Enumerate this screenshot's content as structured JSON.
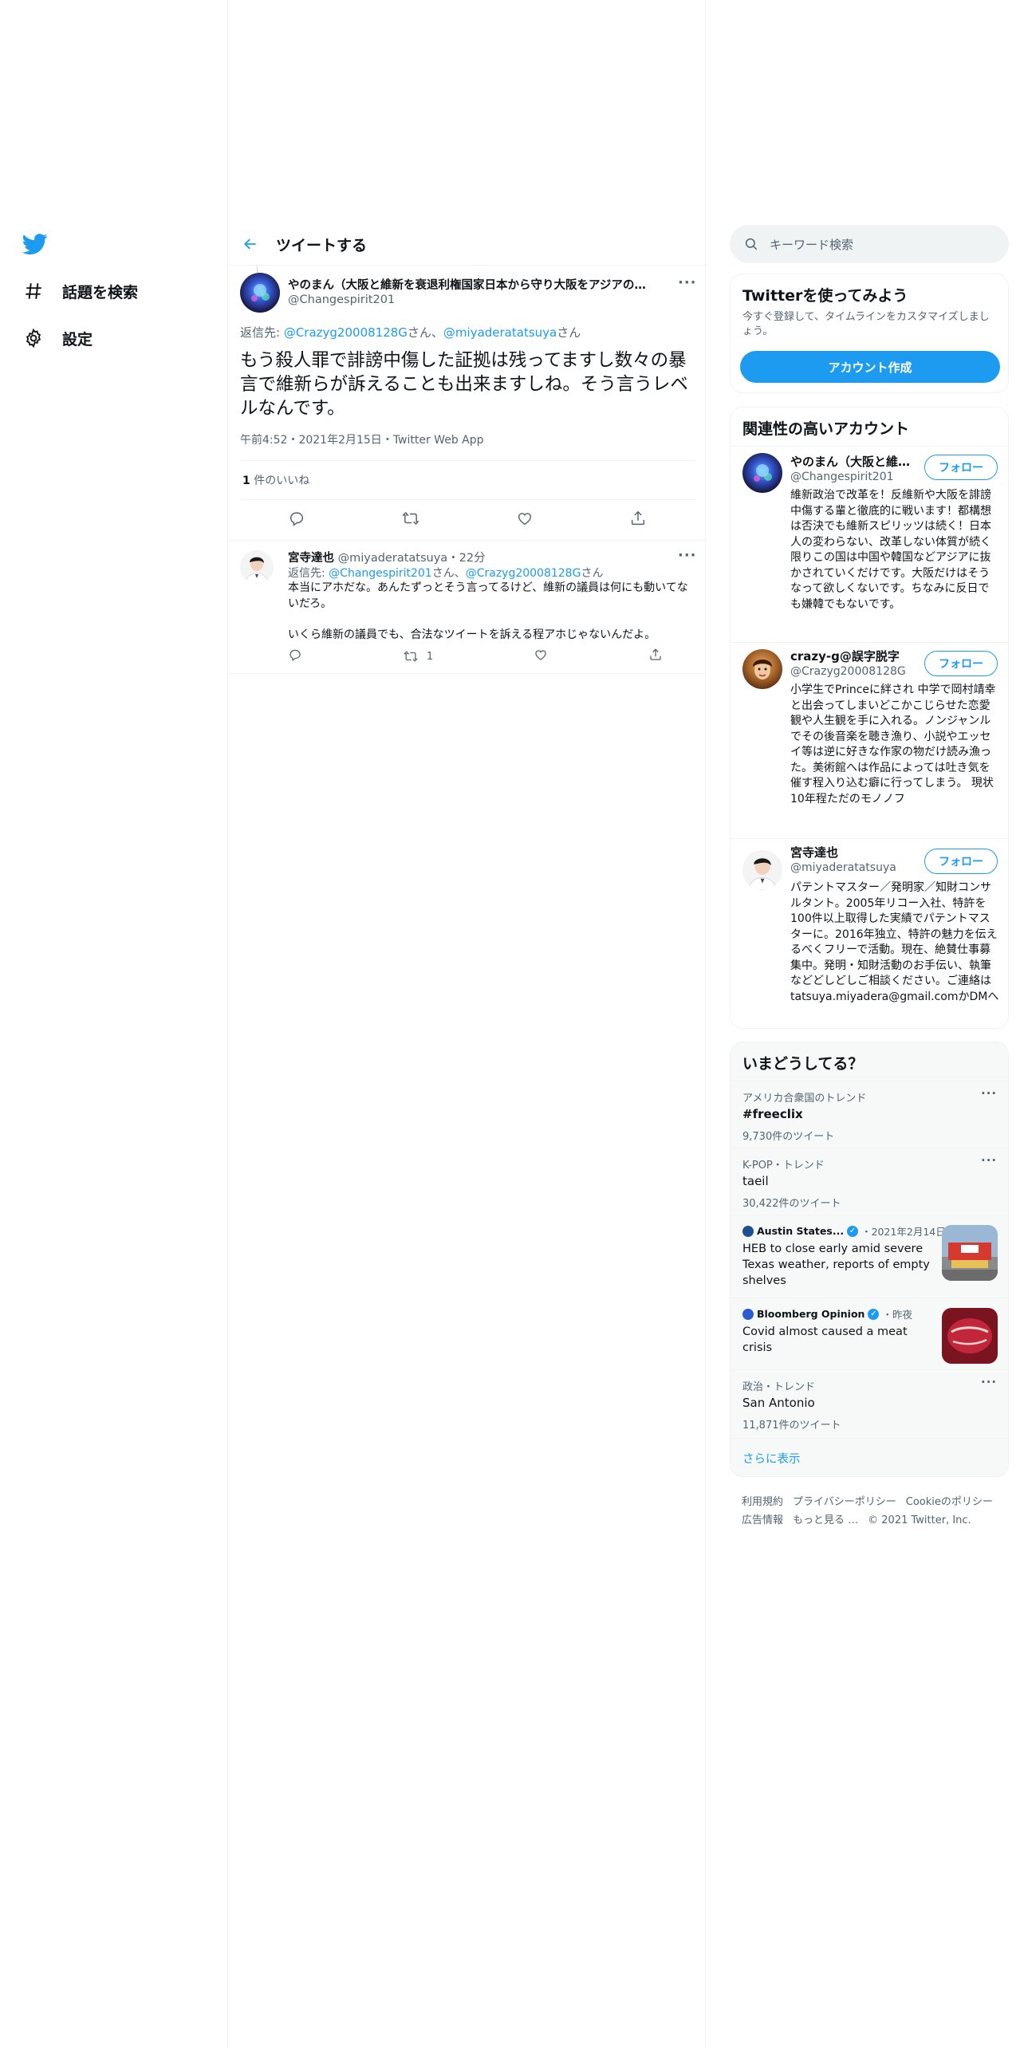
{
  "nav": {
    "explore_label": "話題を検索",
    "settings_label": "設定"
  },
  "header": {
    "title": "ツイートする"
  },
  "main_tweet": {
    "author_name": "やのまん（大阪と維新を衰退利権国家日本から守り大阪をアジアの…",
    "author_handle": "@Changespirit201",
    "reply_prefix": "返信先: ",
    "reply_user1": "@Crazyg20008128G",
    "reply_san1": "さん、",
    "reply_user2": "@miyaderatatsuya",
    "reply_san2": "さん",
    "text": "もう殺人罪で誹謗中傷した証拠は残ってますし数々の暴言で維新らが訴えることも出来ますしね。そう言うレベルなんです。",
    "time": "午前4:52",
    "date": "2021年2月15日",
    "source": "Twitter Web App",
    "sep": "・",
    "like_count": "1",
    "like_label": " 件のいいね"
  },
  "reply_tweet": {
    "author_name": "宮寺達也",
    "author_handle": "@miyaderatatsuya",
    "time": "22分",
    "reply_prefix": "返信先: ",
    "reply_user1": "@Changespirit201",
    "reply_san1": "さん、",
    "reply_user2": "@Crazyg20008128G",
    "reply_san2": "さん",
    "text_line1": "本当にアホだな。あんたずっとそう言ってるけど、維新の議員は何にも動いてないだろ。",
    "text_line2": "いくら維新の議員でも、合法なツイートを訴える程アホじゃないんだよ。",
    "retweet_count": "1"
  },
  "search": {
    "placeholder": "キーワード検索"
  },
  "signup_card": {
    "title": "Twitterを使ってみよう",
    "desc": "今すぐ登録して、タイムラインをカスタマイズしましょう。",
    "button": "アカウント作成"
  },
  "related": {
    "title": "関連性の高いアカウント",
    "follow_label": "フォロー",
    "accounts": [
      {
        "name": "やのまん（大阪と維…",
        "handle": "@Changespirit201",
        "bio": "維新政治で改革を！反維新や大阪を誹謗中傷する輩と徹底的に戦います！都構想は否決でも維新スピリッツは続く！日本人の変わらない、改革しない体質が続く限りこの国は中国や韓国などアジアに抜かされていくだけです。大阪だけはそうなって欲しくないです。ちなみに反日でも嫌韓でもないです。"
      },
      {
        "name": "crazy-g@誤字脱字",
        "handle": "@Crazyg20008128G",
        "bio": "小学生でPrinceに絆され 中学で岡村靖幸と出会ってしまいどこかこじらせた恋愛観や人生観を手に入れる。ノンジャンルでその後音楽を聴き漁り、小説やエッセイ等は逆に好きな作家の物だけ読み漁った。美術館へは作品によっては吐き気を催す程入り込む癖に行ってしまう。 現状10年程ただのモノノフ"
      },
      {
        "name": "宮寺達也",
        "handle": "@miyaderatatsuya",
        "bio": "パテントマスター／発明家／知財コンサルタント。2005年リコー入社、特許を100件以上取得した実績でパテントマスターに。2016年独立、特許の魅力を伝えるべくフリーで活動。現在、絶賛仕事募集中。発明・知財活動のお手伝い、執筆などどしどしご相談ください。ご連絡はtatsuya.miyadera@gmail.comかDMへ"
      }
    ]
  },
  "trends": {
    "title": "いまどうしてる？",
    "items": [
      {
        "context": "アメリカ合衆国のトレンド",
        "name": "#freeclix",
        "count": "9,730件のツイート"
      },
      {
        "context": "K-POP・トレンド",
        "name": "taeil",
        "count": "30,422件のツイート"
      }
    ],
    "news": [
      {
        "source": "Austin States...",
        "time": "・2021年2月14日",
        "headline": "HEB to close early amid severe Texas weather, reports of empty shelves"
      },
      {
        "source": "Bloomberg Opinion",
        "time": "・昨夜",
        "headline": "Covid almost caused a meat crisis"
      }
    ],
    "last": {
      "context": "政治・トレンド",
      "name": "San Antonio",
      "count": "11,871件のツイート"
    },
    "show_more": "さらに表示"
  },
  "footer": {
    "terms": "利用規約",
    "privacy": "プライバシーポリシー",
    "cookie": "Cookieのポリシー",
    "ads": "広告情報",
    "more": "もっと見る …",
    "copyright": "© 2021 Twitter, Inc."
  },
  "colors": {
    "accent": "#1d9bf0",
    "text": "#0f1419",
    "muted": "#536471",
    "border": "#eff3f4"
  }
}
